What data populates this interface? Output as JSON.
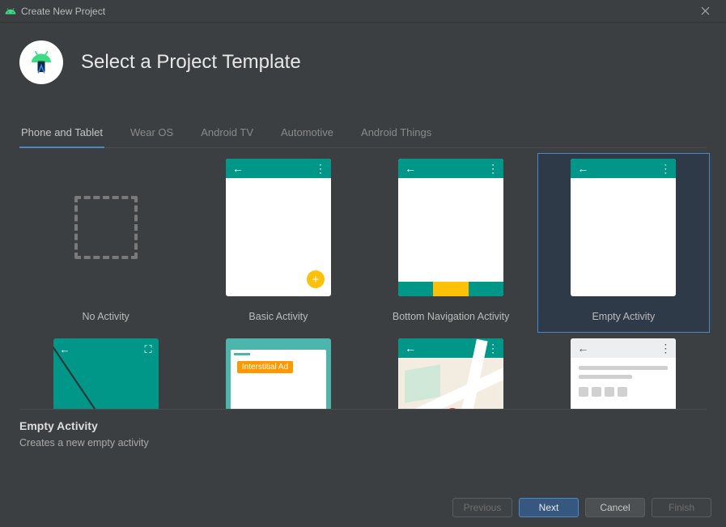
{
  "titlebar": {
    "title": "Create New Project"
  },
  "header": {
    "title": "Select a Project Template"
  },
  "tabs": [
    {
      "label": "Phone and Tablet",
      "active": true
    },
    {
      "label": "Wear OS",
      "active": false
    },
    {
      "label": "Android TV",
      "active": false
    },
    {
      "label": "Automotive",
      "active": false
    },
    {
      "label": "Android Things",
      "active": false
    }
  ],
  "templates": [
    {
      "id": "no-activity",
      "label": "No Activity",
      "selected": false
    },
    {
      "id": "basic-activity",
      "label": "Basic Activity",
      "selected": false
    },
    {
      "id": "bottom-navigation-activity",
      "label": "Bottom Navigation Activity",
      "selected": false
    },
    {
      "id": "empty-activity",
      "label": "Empty Activity",
      "selected": true
    },
    {
      "id": "fullscreen-activity",
      "label": "",
      "selected": false
    },
    {
      "id": "google-admob-ads-activity",
      "label": "",
      "selected": false,
      "badge": "Interstitial Ad"
    },
    {
      "id": "google-maps-activity",
      "label": "",
      "selected": false
    },
    {
      "id": "master-detail-flow",
      "label": "",
      "selected": false
    }
  ],
  "description": {
    "title": "Empty Activity",
    "text": "Creates a new empty activity"
  },
  "footer": {
    "previous": "Previous",
    "next": "Next",
    "cancel": "Cancel",
    "finish": "Finish"
  },
  "colors": {
    "accent": "#4a88c7",
    "teal": "#009688",
    "amber": "#ffc107"
  }
}
